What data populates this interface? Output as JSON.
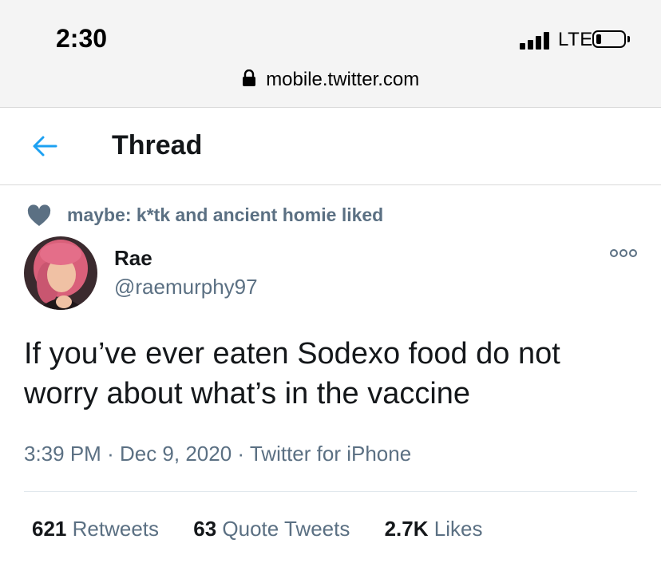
{
  "status_bar": {
    "time": "2:30",
    "network": "LTE"
  },
  "browser": {
    "url": "mobile.twitter.com"
  },
  "header": {
    "title": "Thread"
  },
  "tweet": {
    "social_context": "maybe: k*tk and ancient homie liked",
    "author_name": "Rae",
    "author_handle": "@raemurphy97",
    "text": "If you’ve ever eaten Sodexo food do not worry about what’s in the vaccine",
    "time": "3:39 PM",
    "date": "Dec 9, 2020",
    "source": "Twitter for iPhone",
    "separator": "·",
    "stats": {
      "retweets_count": "621",
      "retweets_label": "Retweets",
      "quotes_count": "63",
      "quotes_label": "Quote Tweets",
      "likes_count": "2.7K",
      "likes_label": "Likes"
    }
  },
  "colors": {
    "twitter_blue": "#1da1f2",
    "secondary_text": "#5b7083",
    "heart_muted": "#5b7083"
  },
  "icons": {
    "back": "arrow-left-icon",
    "heart": "heart-icon",
    "more": "more-options-icon",
    "lock": "lock-icon"
  }
}
